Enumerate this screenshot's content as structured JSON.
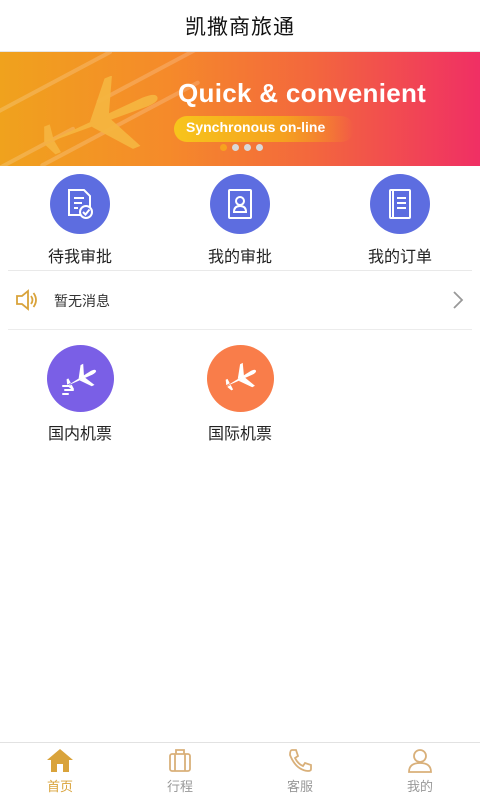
{
  "app": {
    "title": "凯撒商旅通"
  },
  "banner": {
    "headline": "Quick & convenient",
    "subline": "Synchronous on-line",
    "slides": 4,
    "active_slide": 1
  },
  "quick_actions": [
    {
      "label": "待我审批",
      "icon": "document-check-icon"
    },
    {
      "label": "我的审批",
      "icon": "id-card-person-icon"
    },
    {
      "label": "我的订单",
      "icon": "notebook-list-icon"
    }
  ],
  "notice": {
    "text": "暂无消息",
    "icon": "speaker-icon"
  },
  "services": [
    {
      "label": "国内机票",
      "icon": "airplane-departure-icon"
    },
    {
      "label": "国际机票",
      "icon": "airplane-icon"
    }
  ],
  "tabbar": {
    "active": "首页",
    "items": [
      {
        "label": "首页",
        "icon": "home-icon"
      },
      {
        "label": "行程",
        "icon": "suitcase-icon"
      },
      {
        "label": "客服",
        "icon": "phone-icon"
      },
      {
        "label": "我的",
        "icon": "user-icon"
      }
    ]
  },
  "colors": {
    "accent": "#d9a33b",
    "icon_blue": "#5d6de0",
    "icon_purple": "#7a5fe6",
    "icon_orange": "#f97d4a"
  }
}
